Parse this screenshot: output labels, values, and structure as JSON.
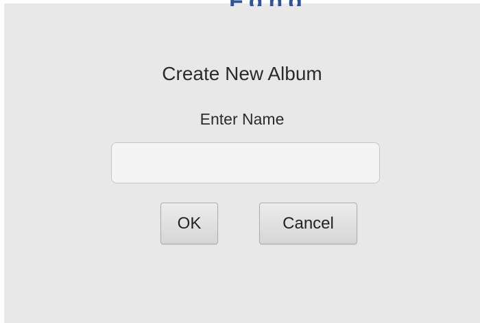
{
  "dialog": {
    "title_fragment": "Fqhq",
    "heading": "Create New Album",
    "prompt": "Enter Name",
    "name_value": "",
    "name_placeholder": "",
    "ok_label": "OK",
    "cancel_label": "Cancel"
  },
  "colors": {
    "dialog_background": "#e8e8e8",
    "window_background": "#ffffff",
    "title_fragment": "#2f5597",
    "text": "#2b2b2b",
    "field_background": "#f4f4f4",
    "button_background": "#e0e0e0"
  }
}
